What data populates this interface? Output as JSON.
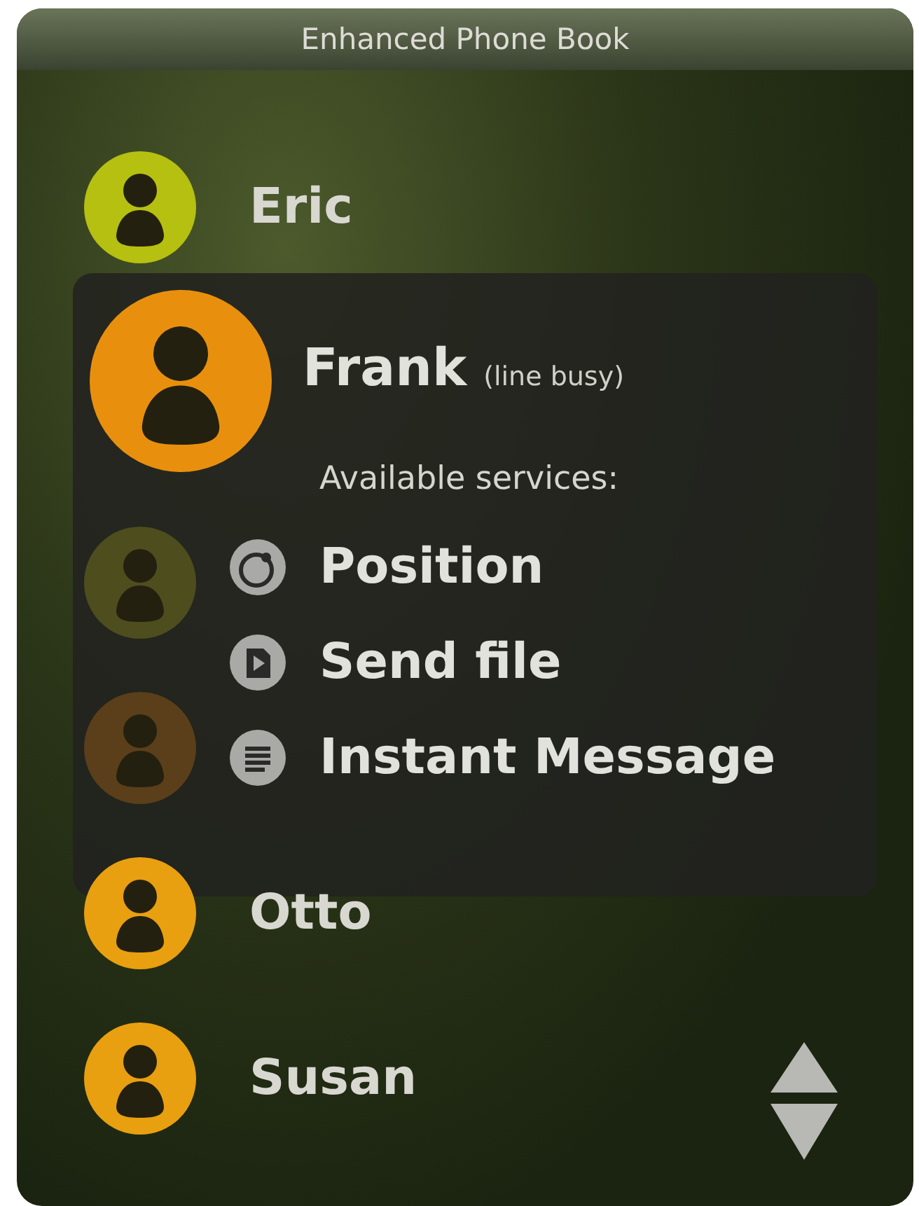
{
  "window": {
    "title": "Enhanced Phone Book"
  },
  "contacts": [
    {
      "name": "Eric",
      "color": "#b5c011"
    },
    {
      "color": "#4e4d1e"
    },
    {
      "color": "#5a3f1a"
    },
    {
      "name": "Otto",
      "color": "#e8a010"
    },
    {
      "name": "Susan",
      "color": "#e8a010"
    }
  ],
  "popup": {
    "contact": {
      "name": "Frank",
      "status": "(line busy)",
      "color": "#e8900e"
    },
    "heading": "Available services:",
    "services": [
      {
        "kind": "position",
        "label": "Position"
      },
      {
        "kind": "file",
        "label": "Send file"
      },
      {
        "kind": "message",
        "label": "Instant Message"
      }
    ]
  }
}
